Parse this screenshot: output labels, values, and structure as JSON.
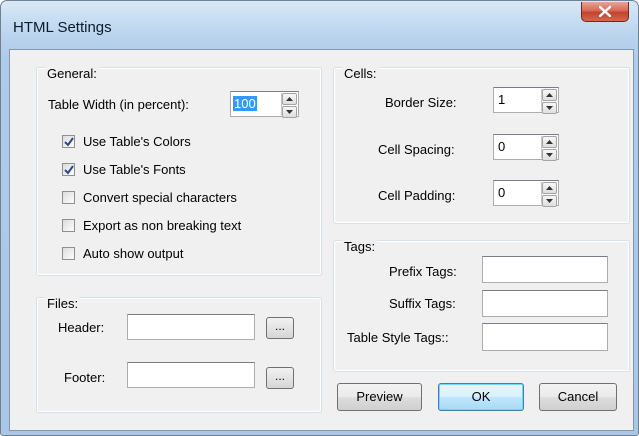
{
  "window": {
    "title": "HTML Settings"
  },
  "general": {
    "title": "General:",
    "table_width_label": "Table Width (in percent):",
    "table_width_value": "100",
    "checkboxes": [
      {
        "label": "Use Table's Colors",
        "checked": true
      },
      {
        "label": "Use Table's Fonts",
        "checked": true
      },
      {
        "label": "Convert special characters",
        "checked": false
      },
      {
        "label": "Export as non breaking text",
        "checked": false
      },
      {
        "label": "Auto show output",
        "checked": false
      }
    ]
  },
  "files": {
    "title": "Files:",
    "header_label": "Header:",
    "header_value": "",
    "footer_label": "Footer:",
    "footer_value": "",
    "browse_label": "..."
  },
  "cells": {
    "title": "Cells:",
    "border_size_label": "Border Size:",
    "border_size_value": "1",
    "cell_spacing_label": "Cell Spacing:",
    "cell_spacing_value": "0",
    "cell_padding_label": "Cell Padding:",
    "cell_padding_value": "0"
  },
  "tags": {
    "title": "Tags:",
    "prefix_label": "Prefix Tags:",
    "prefix_value": "",
    "suffix_label": "Suffix Tags:",
    "suffix_value": "",
    "table_style_label": "Table Style Tags::",
    "table_style_value": ""
  },
  "buttons": {
    "preview": "Preview",
    "ok": "OK",
    "cancel": "Cancel"
  },
  "colors": {
    "selection": "#3399ff",
    "close_red": "#c1432e"
  }
}
